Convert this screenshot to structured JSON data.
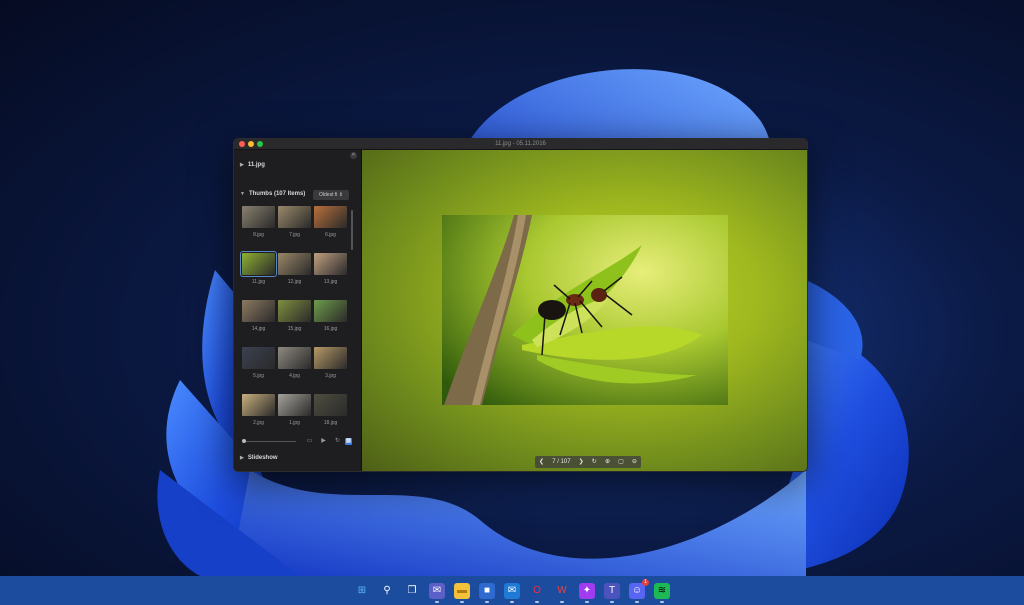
{
  "window": {
    "title": "11.jpg - 05.11.2016"
  },
  "sidebar": {
    "current_file": "11.jpg",
    "thumbs_header": "Thumbs (107 Items)",
    "sort_label": "Oldest fi ⇕",
    "slideshow_label": "Slideshow",
    "thumbnails": [
      {
        "label": "8.jpg",
        "color": "#8a8270"
      },
      {
        "label": "7.jpg",
        "color": "#9b8a6a"
      },
      {
        "label": "6.jpg",
        "color": "#b9703a"
      },
      {
        "label": "11.jpg",
        "color": "#8fb033",
        "selected": true
      },
      {
        "label": "12.jpg",
        "color": "#9b8768"
      },
      {
        "label": "13.jpg",
        "color": "#c0a080"
      },
      {
        "label": "14.jpg",
        "color": "#8d7a61"
      },
      {
        "label": "15.jpg",
        "color": "#7f8f3e"
      },
      {
        "label": "16.jpg",
        "color": "#6f9c4a"
      },
      {
        "label": "5.jpg",
        "color": "#3b4150"
      },
      {
        "label": "4.jpg",
        "color": "#8f8a82"
      },
      {
        "label": "3.jpg",
        "color": "#b79a66"
      },
      {
        "label": "2.jpg",
        "color": "#c9b07e"
      },
      {
        "label": "1.jpg",
        "color": "#a5a29a"
      },
      {
        "label": "18.jpg",
        "color": "#4f4e40"
      }
    ]
  },
  "viewer": {
    "counter": "7 / 107"
  },
  "taskbar": {
    "icons": [
      {
        "name": "windows-start-icon",
        "glyph": "⊞",
        "bg": "#1b4c9e",
        "fg": "#5fb7ff"
      },
      {
        "name": "search-icon",
        "glyph": "⚲",
        "bg": "#1b4c9e",
        "fg": "#ffffff"
      },
      {
        "name": "task-view-icon",
        "glyph": "❐",
        "bg": "#1b4c9e",
        "fg": "#ffffff"
      },
      {
        "name": "teams-chat-icon",
        "glyph": "✉",
        "bg": "#5b5fc7",
        "fg": "#ffffff"
      },
      {
        "name": "file-explorer-icon",
        "glyph": "▬",
        "bg": "#f3c23a",
        "fg": "#b07b12"
      },
      {
        "name": "store-icon",
        "glyph": "■",
        "bg": "#2f6ad0",
        "fg": "#ffffff"
      },
      {
        "name": "mail-icon",
        "glyph": "✉",
        "bg": "#1f7ad6",
        "fg": "#ffffff"
      },
      {
        "name": "opera-icon",
        "glyph": "O",
        "bg": "#1b4c9e",
        "fg": "#ff2a43"
      },
      {
        "name": "wps-office-icon",
        "glyph": "W",
        "bg": "#1b4c9e",
        "fg": "#ff3b3b"
      },
      {
        "name": "messenger-icon",
        "glyph": "✦",
        "bg": "#a03bf0",
        "fg": "#ffffff"
      },
      {
        "name": "teams-icon",
        "glyph": "T",
        "bg": "#4b53bc",
        "fg": "#ffffff"
      },
      {
        "name": "discord-icon",
        "glyph": "☺",
        "bg": "#5865f2",
        "fg": "#ffffff",
        "badge": "1"
      },
      {
        "name": "spotify-icon",
        "glyph": "≋",
        "bg": "#1db954",
        "fg": "#000000"
      }
    ]
  }
}
